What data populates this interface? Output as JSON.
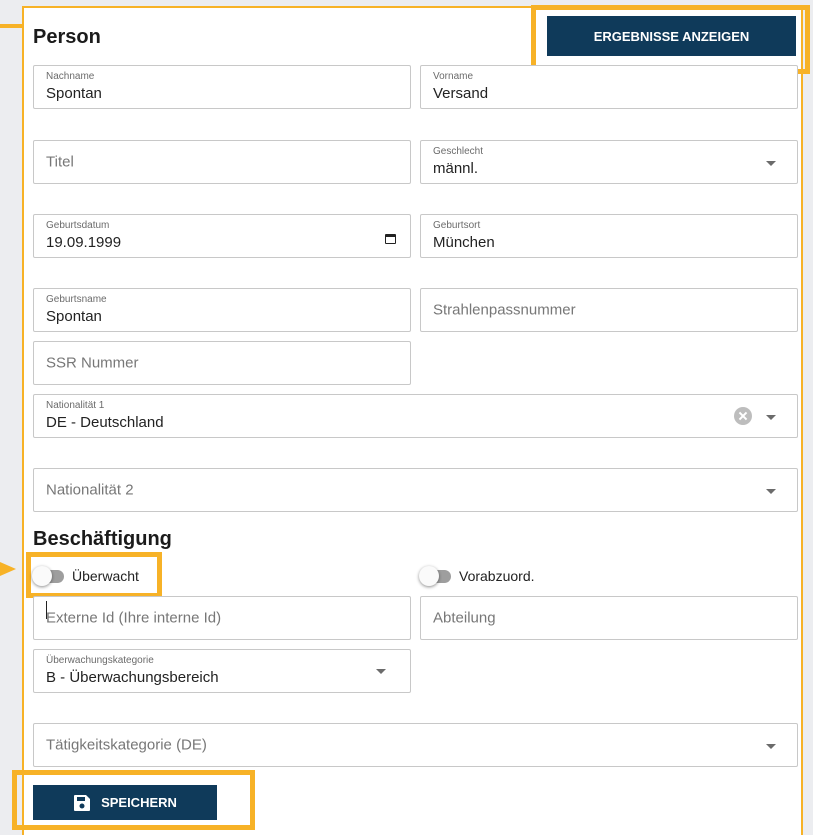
{
  "colors": {
    "accent": "#f7b227",
    "button": "#0f3a5a"
  },
  "person": {
    "heading": "Person",
    "show_results_label": "ERGEBNISSE ANZEIGEN",
    "nachname": {
      "label": "Nachname",
      "value": "Spontan"
    },
    "vorname": {
      "label": "Vorname",
      "value": "Versand"
    },
    "titel": {
      "placeholder": "Titel"
    },
    "geschlecht": {
      "label": "Geschlecht",
      "value": "männl."
    },
    "geburtsdatum": {
      "label": "Geburtsdatum",
      "value": "19.09.1999"
    },
    "geburtsort": {
      "label": "Geburtsort",
      "value": "München"
    },
    "geburtsname": {
      "label": "Geburtsname",
      "value": "Spontan"
    },
    "strahlenpass": {
      "placeholder": "Strahlenpassnummer"
    },
    "ssr": {
      "placeholder": "SSR Nummer"
    },
    "nationalitaet1": {
      "label": "Nationalität 1",
      "value": "DE - Deutschland"
    },
    "nationalitaet2": {
      "placeholder": "Nationalität 2"
    }
  },
  "employment": {
    "heading": "Beschäftigung",
    "monitored_label": "Überwacht",
    "preassign_label": "Vorabzuord.",
    "external_id": {
      "placeholder": "Externe Id (Ihre interne Id)"
    },
    "abteilung": {
      "placeholder": "Abteilung"
    },
    "kategorie": {
      "label": "Überwachungskategorie",
      "value": "B - Überwachungsbereich"
    },
    "taetigkeit": {
      "placeholder": "Tätigkeitskategorie (DE)"
    }
  },
  "footer": {
    "save_label": "SPEICHERN",
    "save_icon": "floppy-disk-icon"
  }
}
